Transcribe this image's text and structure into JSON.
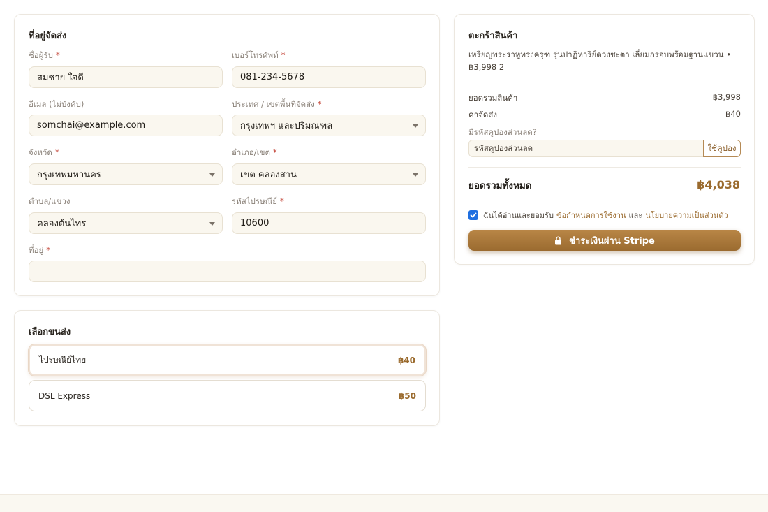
{
  "address": {
    "title": "ที่อยู่จัดส่ง",
    "recipient_label": "ชื่อผู้รับ",
    "recipient_value": "สมชาย ใจดี",
    "phone_label": "เบอร์โทรศัพท์",
    "phone_value": "081-234-5678",
    "email_label": "อีเมล (ไม่บังคับ)",
    "email_value": "somchai@example.com",
    "country_label": "ประเทศ / เขตพื้นที่จัดส่ง",
    "country_value": "กรุงเทพฯ และปริมณฑล",
    "province_label": "จังหวัด",
    "province_value": "กรุงเทพมหานคร",
    "district_label": "อำเภอ/เขต",
    "district_value": "เขต คลองสาน",
    "subdistrict_label": "ตำบล/แขวง",
    "subdistrict_value": "คลองต้นไทร",
    "postal_label": "รหัสไปรษณีย์",
    "postal_value": "10600",
    "street_label": "ที่อยู่",
    "street_value": "",
    "required_mark": "*"
  },
  "shipping": {
    "title": "เลือกขนส่ง",
    "options": [
      {
        "name": "ไปรษณีย์ไทย",
        "price": "฿40"
      },
      {
        "name": "DSL Express",
        "price": "฿50"
      }
    ]
  },
  "cart": {
    "title": "ตะกร้าสินค้า",
    "item_text": "เหรียญพระราหูทรงครุฑ รุ่นปาฏิหาริย์ดวงชะตา เลี่ยมกรอบพร้อมฐานแขวน • ฿3,998 2",
    "subtotal_label": "ยอดรวมสินค้า",
    "subtotal_value": "฿3,998",
    "shipping_label": "ค่าจัดส่ง",
    "shipping_value": "฿40",
    "coupon_question": "มีรหัสคูปองส่วนลด?",
    "coupon_placeholder": "รหัสคูปองส่วนลด",
    "coupon_button": "ใช้คูปอง",
    "total_label": "ยอดรวมทั้งหมด",
    "total_value": "฿4,038",
    "agree_prefix": "ฉันได้อ่านและยอมรับ",
    "terms_link": "ข้อกำหนดการใช้งาน",
    "agree_and": "และ",
    "privacy_link": "นโยบายความเป็นส่วนตัว",
    "agree_checked": true,
    "pay_button": "ชำระเงินผ่าน Stripe"
  },
  "colors": {
    "accent": "#9a6a2d",
    "checkbox": "#1f6fe0",
    "required": "#c0392b"
  }
}
